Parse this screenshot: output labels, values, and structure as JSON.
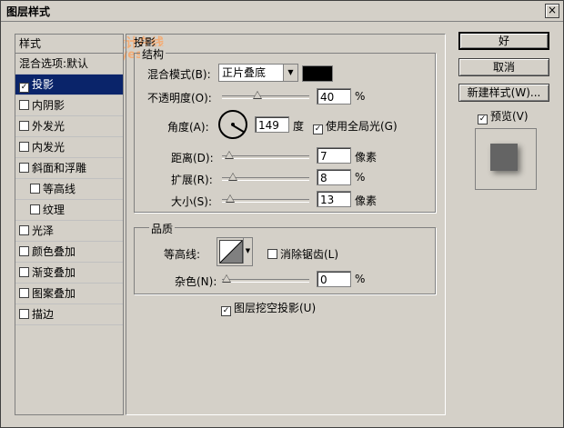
{
  "window": {
    "title": "图层样式",
    "close_glyph": "×"
  },
  "watermark": {
    "line1": "天极设计在线",
    "line2": "design.yesky"
  },
  "sidebar": {
    "header": "样式",
    "items": [
      {
        "label": "混合选项:默认",
        "checkbox": false,
        "indent": false,
        "selected": false
      },
      {
        "label": "投影",
        "checkbox": true,
        "checked": true,
        "indent": false,
        "selected": true
      },
      {
        "label": "内阴影",
        "checkbox": true,
        "checked": false,
        "indent": false,
        "selected": false
      },
      {
        "label": "外发光",
        "checkbox": true,
        "checked": false,
        "indent": false,
        "selected": false
      },
      {
        "label": "内发光",
        "checkbox": true,
        "checked": false,
        "indent": false,
        "selected": false
      },
      {
        "label": "斜面和浮雕",
        "checkbox": true,
        "checked": false,
        "indent": false,
        "selected": false
      },
      {
        "label": "等高线",
        "checkbox": true,
        "checked": false,
        "indent": true,
        "selected": false
      },
      {
        "label": "纹理",
        "checkbox": true,
        "checked": false,
        "indent": true,
        "selected": false
      },
      {
        "label": "光泽",
        "checkbox": true,
        "checked": false,
        "indent": false,
        "selected": false
      },
      {
        "label": "颜色叠加",
        "checkbox": true,
        "checked": false,
        "indent": false,
        "selected": false
      },
      {
        "label": "渐变叠加",
        "checkbox": true,
        "checked": false,
        "indent": false,
        "selected": false
      },
      {
        "label": "图案叠加",
        "checkbox": true,
        "checked": false,
        "indent": false,
        "selected": false
      },
      {
        "label": "描边",
        "checkbox": true,
        "checked": false,
        "indent": false,
        "selected": false
      }
    ]
  },
  "drop_shadow": {
    "section_title": "投影",
    "structure_title": "结构",
    "blend_mode_label": "混合模式(B):",
    "blend_mode_value": "正片叠底",
    "shadow_color": "#000000",
    "opacity_label": "不透明度(O):",
    "opacity_value": "40",
    "opacity_fraction": 0.4,
    "opacity_unit": "%",
    "angle_label": "角度(A):",
    "angle_value": "149",
    "angle_unit": "度",
    "global_light_label": "使用全局光(G)",
    "global_light_checked": true,
    "distance_label": "距离(D):",
    "distance_value": "7",
    "distance_unit": "像素",
    "distance_fraction": 0.03,
    "spread_label": "扩展(R):",
    "spread_value": "8",
    "spread_unit": "%",
    "spread_fraction": 0.08,
    "size_label": "大小(S):",
    "size_value": "13",
    "size_unit": "像素",
    "size_fraction": 0.05,
    "quality_title": "品质",
    "contour_label": "等高线:",
    "antialias_label": "消除锯齿(L)",
    "antialias_checked": false,
    "noise_label": "杂色(N):",
    "noise_value": "0",
    "noise_unit": "%",
    "noise_fraction": 0.0,
    "knockout_label": "图层挖空投影(U)",
    "knockout_checked": true
  },
  "buttons": {
    "ok": "好",
    "cancel": "取消",
    "new_style": "新建样式(W)...",
    "preview_label": "预览(V)",
    "preview_checked": true
  }
}
